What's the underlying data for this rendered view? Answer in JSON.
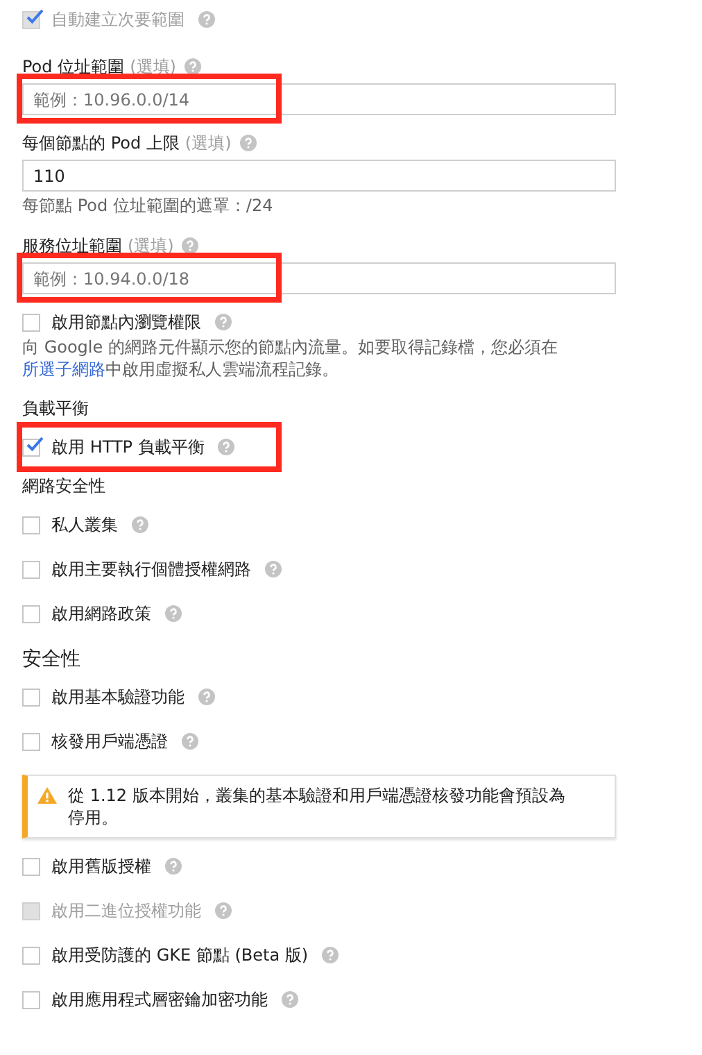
{
  "items": [
    {
      "kind": "checkbox",
      "label": "自動建立次要範圍",
      "checked": true,
      "disabled": true,
      "help": true,
      "highlighted": false
    },
    {
      "kind": "field",
      "label": "Pod 位址範圍",
      "optional": "(選填)",
      "help": true,
      "placeholder": "範例：10.96.0.0/14",
      "highlighted": true
    },
    {
      "kind": "field",
      "label": "每個節點的 Pod 上限",
      "optional": "(選填)",
      "help": true,
      "value": "110",
      "hint": "每節點 Pod 位址範圍的遮罩：/24",
      "highlighted": false
    },
    {
      "kind": "field",
      "label": "服務位址範圍",
      "optional": "(選填)",
      "help": true,
      "placeholder": "範例：10.94.0.0/18",
      "highlighted": true
    },
    {
      "kind": "checkbox",
      "label": "啟用節點內瀏覽權限",
      "checked": false,
      "disabled": false,
      "help": true,
      "highlighted": false,
      "description": {
        "before": "向 Google 的網路元件顯示您的節點內流量。如要取得記錄檔，您必須在",
        "link": "所選子網路",
        "after": "中啟用虛擬私人雲端流程記錄。"
      }
    },
    {
      "kind": "group_label",
      "label": "負載平衡"
    },
    {
      "kind": "checkbox",
      "label": "啟用 HTTP 負載平衡",
      "checked": true,
      "disabled": false,
      "help": true,
      "highlighted": true
    },
    {
      "kind": "group_label",
      "label": "網路安全性"
    },
    {
      "kind": "checkbox",
      "label": "私人叢集",
      "checked": false,
      "disabled": false,
      "help": true,
      "highlighted": false
    },
    {
      "kind": "checkbox",
      "label": "啟用主要執行個體授權網路",
      "checked": false,
      "disabled": false,
      "help": true,
      "highlighted": false
    },
    {
      "kind": "checkbox",
      "label": "啟用網路政策",
      "checked": false,
      "disabled": false,
      "help": true,
      "highlighted": false
    },
    {
      "kind": "heading",
      "label": "安全性"
    },
    {
      "kind": "checkbox",
      "label": "啟用基本驗證功能",
      "checked": false,
      "disabled": false,
      "help": true,
      "highlighted": false
    },
    {
      "kind": "checkbox",
      "label": "核發用戶端憑證",
      "checked": false,
      "disabled": false,
      "help": true,
      "highlighted": false
    },
    {
      "kind": "warning",
      "text": "從 1.12 版本開始，叢集的基本驗證和用戶端憑證核發功能會預設為停用。"
    },
    {
      "kind": "checkbox",
      "label": "啟用舊版授權",
      "checked": false,
      "disabled": false,
      "help": true,
      "highlighted": false
    },
    {
      "kind": "checkbox",
      "label": "啟用二進位授權功能",
      "checked": false,
      "disabled": true,
      "help": true,
      "highlighted": false
    },
    {
      "kind": "checkbox",
      "label": "啟用受防護的 GKE 節點 (Beta 版)",
      "checked": false,
      "disabled": false,
      "help": true,
      "highlighted": false
    },
    {
      "kind": "checkbox",
      "label": "啟用應用程式層密鑰加密功能",
      "checked": false,
      "disabled": false,
      "help": true,
      "highlighted": false
    }
  ]
}
